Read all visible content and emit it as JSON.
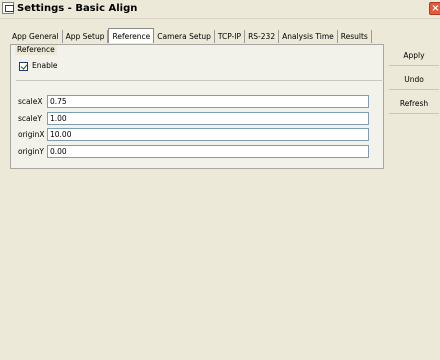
{
  "window": {
    "title": "Settings - Basic Align",
    "close_glyph": "×"
  },
  "tabs": [
    {
      "label": "App General"
    },
    {
      "label": "App Setup"
    },
    {
      "label": "Reference",
      "active": true
    },
    {
      "label": "Camera Setup"
    },
    {
      "label": "TCP-IP"
    },
    {
      "label": "RS-232"
    },
    {
      "label": "Analysis Time"
    },
    {
      "label": "Results"
    }
  ],
  "reference_group": {
    "legend": "Reference",
    "enable": {
      "label": "Enable",
      "checked": true
    },
    "fields": [
      {
        "label": "scaleX",
        "value": "0.75"
      },
      {
        "label": "scaleY",
        "value": "1.00"
      },
      {
        "label": "originX",
        "value": "10.00"
      },
      {
        "label": "originY",
        "value": "0.00"
      }
    ]
  },
  "buttons": {
    "apply": "Apply",
    "undo": "Undo",
    "refresh": "Refresh"
  },
  "colors": {
    "window_bg": "#ece9d8",
    "close_button": "#e15a3c",
    "input_border": "#7f9db9"
  },
  "icons": {
    "window_icon": "settings-window-icon",
    "close": "close-icon"
  }
}
